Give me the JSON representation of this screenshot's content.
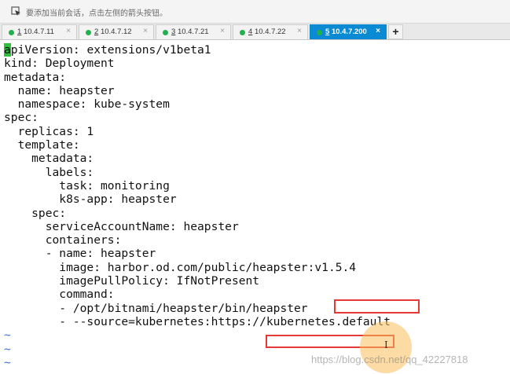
{
  "hint_bar": {
    "icon": "send-session-icon",
    "text": "要添加当前会话，点击左侧的箭头按钮。"
  },
  "tabs": [
    {
      "index": "1",
      "label": "10.4.7.11",
      "active": false
    },
    {
      "index": "2",
      "label": "10.4.7.12",
      "active": false
    },
    {
      "index": "3",
      "label": "10.4.7.21",
      "active": false
    },
    {
      "index": "4",
      "label": "10.4.7.22",
      "active": false
    },
    {
      "index": "5",
      "label": "10.4.7.200",
      "active": true
    }
  ],
  "tab_close_glyph": "×",
  "add_tab_glyph": "+",
  "terminal": {
    "cursor_char": "a",
    "first_line_rest": "piVersion: extensions/v1beta1",
    "lines": [
      "kind: Deployment",
      "metadata:",
      "  name: heapster",
      "  namespace: kube-system",
      "spec:",
      "  replicas: 1",
      "  template:",
      "    metadata:",
      "      labels:",
      "        task: monitoring",
      "        k8s-app: heapster",
      "    spec:",
      "      serviceAccountName: heapster",
      "      containers:",
      "      - name: heapster",
      "        image: harbor.od.com/public/heapster:v1.5.4",
      "        imagePullPolicy: IfNotPresent",
      "        command:",
      "        - /opt/bitnami/heapster/bin/heapster",
      "        - --source=kubernetes:https://kubernetes.default"
    ],
    "tilde_lines": [
      "~",
      "~",
      "~"
    ]
  },
  "pointer_glyph": "I",
  "watermark": "https://blog.csdn.net/qq_42227818",
  "colors": {
    "active_tab": "#0a8ad2",
    "status_dot": "#22b14c",
    "cursor": "#2fbf3a",
    "highlight_box": "#e53935",
    "tilde": "#3f6fd6"
  }
}
